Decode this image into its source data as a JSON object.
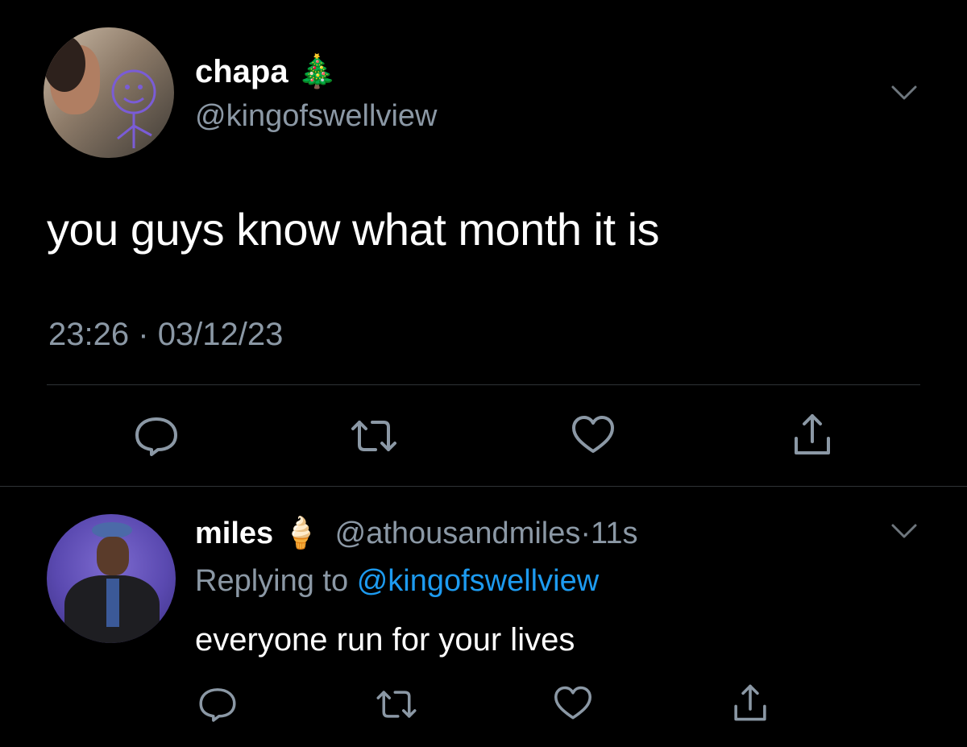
{
  "tweet": {
    "display_name": "chapa",
    "name_emoji": "🎄",
    "handle": "@kingofswellview",
    "text": "you guys know what month it is",
    "time": "23:26",
    "separator": "·",
    "date": "03/12/23",
    "actions": [
      "reply-icon",
      "retweet-icon",
      "like-icon",
      "share-icon"
    ]
  },
  "reply": {
    "display_name": "miles",
    "name_emoji": "🍦",
    "handle": "@athousandmiles",
    "separator": "·",
    "age": "11s",
    "replying_prefix": "Replying to",
    "replying_handle": "@kingofswellview",
    "text": "everyone run for your lives",
    "actions": [
      "reply-icon",
      "retweet-icon",
      "like-icon",
      "share-icon"
    ]
  },
  "colors": {
    "background": "#000000",
    "text": "#ffffff",
    "muted": "#8b98a5",
    "link": "#1d9bf0",
    "divider": "#2f3336"
  }
}
